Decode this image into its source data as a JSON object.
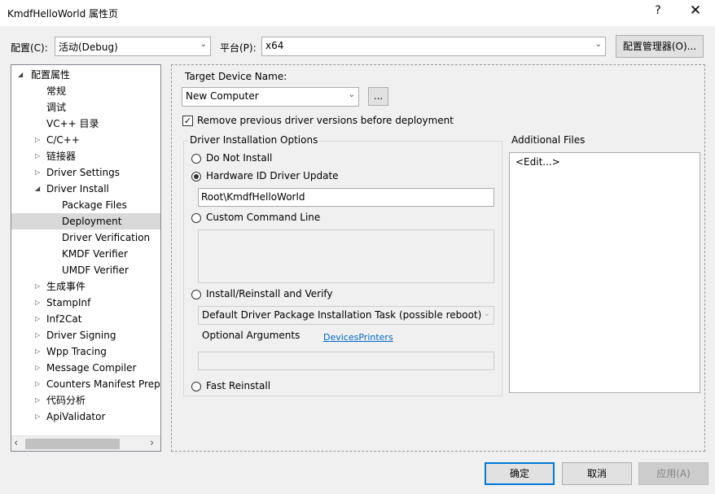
{
  "window": {
    "title": "KmdfHelloWorld 属性页",
    "help_glyph": "?",
    "close_glyph": "✕"
  },
  "config": {
    "config_label": "配置(C):",
    "config_value": "活动(Debug)",
    "platform_label": "平台(P):",
    "platform_value": "x64",
    "manager_button": "配置管理器(O)..."
  },
  "tree": {
    "root": "配置属性",
    "items": [
      {
        "label": "常规"
      },
      {
        "label": "调试"
      },
      {
        "label": "VC++ 目录"
      },
      {
        "label": "C/C++"
      },
      {
        "label": "链接器"
      },
      {
        "label": "Driver Settings"
      },
      {
        "label": "Driver Install"
      },
      {
        "label": "Package Files"
      },
      {
        "label": "Deployment"
      },
      {
        "label": "Driver Verification"
      },
      {
        "label": "KMDF Verifier"
      },
      {
        "label": "UMDF Verifier"
      },
      {
        "label": "生成事件"
      },
      {
        "label": "StampInf"
      },
      {
        "label": "Inf2Cat"
      },
      {
        "label": "Driver Signing"
      },
      {
        "label": "Wpp Tracing"
      },
      {
        "label": "Message Compiler"
      },
      {
        "label": "Counters Manifest Preprocessor"
      },
      {
        "label": "代码分析"
      },
      {
        "label": "ApiValidator"
      }
    ],
    "selected": "Deployment"
  },
  "deployment": {
    "target_label": "Target Device Name:",
    "target_value": "New Computer",
    "browse_button": "...",
    "remove_previous_label": "Remove previous driver versions before deployment",
    "remove_previous_checked": true,
    "install_group_title": "Driver Installation Options",
    "options": {
      "do_not_install": "Do Not Install",
      "hardware_id": "Hardware ID Driver Update",
      "custom_command": "Custom Command Line",
      "install_reinstall": "Install/Reinstall and Verify",
      "fast_reinstall": "Fast Reinstall"
    },
    "selected_option": "Hardware ID Driver Update",
    "hardware_id_value": "Root\\KmdfHelloWorld",
    "task_value": "Default Driver Package Installation Task (possible reboot)",
    "optional_args_label": "Optional Arguments",
    "devices_link": "DevicesPrinters",
    "additional_files_title": "Additional Files",
    "additional_files_value": "<Edit...>"
  },
  "footer": {
    "ok": "确定",
    "cancel": "取消",
    "apply": "应用(A)"
  }
}
